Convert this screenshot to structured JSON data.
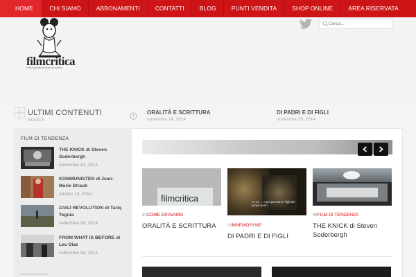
{
  "nav": {
    "items": [
      "HOME",
      "CHI SIAMO",
      "ABBONAMENTI",
      "CONTATTI",
      "BLOG",
      "PUNTI VENDITA",
      "SHOP ONLINE",
      "AREA RISERVATA"
    ],
    "active_index": 0
  },
  "header": {
    "logo_text": "filmcritica",
    "logo_tagline": "rivista mensile di studi sul cinema",
    "search_placeholder": "Cerca..."
  },
  "latest": {
    "title": "ULTIMI CONTENUTI",
    "subtitle": "NOVITÀ",
    "posts": [
      {
        "title": "ORALITÀ E SCRITTURA",
        "date": "novembre 24, 2014"
      },
      {
        "title": "DI PADRI E DI FIGLI",
        "date": "novembre 20, 2014"
      }
    ]
  },
  "sidebar": {
    "heading": "FILM DI TENDENZA",
    "items": [
      {
        "title": "THE KNICK di Steven Soderbergh",
        "date": "novembre 12, 2014"
      },
      {
        "title": "KOMMUNISTEN di Jean-Marie Straub",
        "date": "ottobre 10, 2014"
      },
      {
        "title": "ZANJ REVOLUTION di Tariq Teguia",
        "date": "settembre 29, 2014"
      },
      {
        "title": "FROM WHAT IS BEFORE di Lav Diaz",
        "date": "settembre 16, 2014"
      }
    ]
  },
  "cards": [
    {
      "in": "IN",
      "category": "COME ERAVAMO",
      "title": "ORALITÀ E SCRITTURA",
      "image_text": "filmcritica"
    },
    {
      "in": "IN",
      "category": "MNEMOSYNE",
      "title": "DI PADRI E DI FIGLI",
      "image_caption": "Lo so ... cosa pensano i figli dei propri padri"
    },
    {
      "in": "IN",
      "category": "FILM DI TENDENZA",
      "title": "THE KNICK di Steven Soderbergh"
    }
  ],
  "colors": {
    "brand": "#cd1417",
    "nav_active": "#e2282b"
  }
}
